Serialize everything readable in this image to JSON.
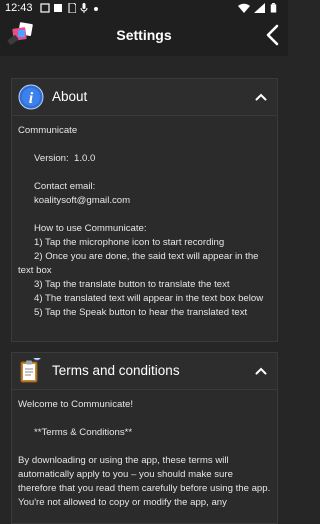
{
  "status_bar": {
    "time": "12:43",
    "icons": [
      "notification-icon",
      "notification-icon",
      "sim-icon",
      "mic-icon",
      "dot-icon",
      "wifi-icon",
      "signal-icon",
      "battery-icon"
    ]
  },
  "app_bar": {
    "title": "Settings"
  },
  "about": {
    "title": "About",
    "lines": [
      "Communicate",
      "",
      "      Version:  1.0.0",
      "",
      "      Contact email:",
      "      koalitysoft@gmail.com",
      "",
      "      How to use Communicate:",
      "      1) Tap the microphone icon to start recording",
      "      2) Once you are done, the said text will appear in the text box",
      "      3) Tap the translate button to translate the text",
      "      4) The translated text will appear in the text box below",
      "      5) Tap the Speak button to hear the translated text"
    ]
  },
  "terms": {
    "title": "Terms and conditions",
    "lines": [
      "Welcome to Communicate!",
      "",
      "      **Terms & Conditions**",
      "",
      "By downloading or using the app, these terms will automatically apply to you – you should make sure therefore that you read them carefully before using the app. You're not allowed to copy or modify the app, any"
    ]
  },
  "colors": {
    "background": "#262626",
    "bar": "#1f1f1f",
    "info_blue": "#2f6fd6"
  }
}
